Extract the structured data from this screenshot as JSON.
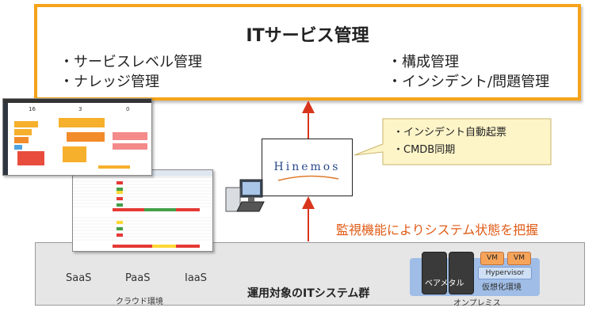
{
  "itsm": {
    "title": "ITサービス管理",
    "features_left": [
      "・サービスレベル管理",
      "・ナレッジ管理"
    ],
    "features_right": [
      "・構成管理",
      "・インシデント/問題管理"
    ]
  },
  "hinemos": {
    "logo": "Hinemos",
    "callout": [
      "・インシデント自動起票",
      "・CMDB同期"
    ]
  },
  "monitor_text": "監視機能によりシステム状態を把握",
  "systems": {
    "label": "運用対象のITシステム群",
    "clouds": [
      "SaaS",
      "PaaS",
      "IaaS"
    ],
    "cloud_group_label": "クラウド環境",
    "baremetal_label": "ベアメタル",
    "vm_label": "VM",
    "hypervisor_label": "Hypervisor",
    "virtual_label": "仮想化環境",
    "onprem_label": "オンプレミス"
  },
  "dashboard": {
    "counts": [
      "16",
      "3",
      "0"
    ]
  },
  "colors": {
    "orange_border": "#f5a31a",
    "arrow_red": "#d9351c",
    "monitor_text": "#e05a14",
    "callout_bg": "#fdf4c8"
  }
}
